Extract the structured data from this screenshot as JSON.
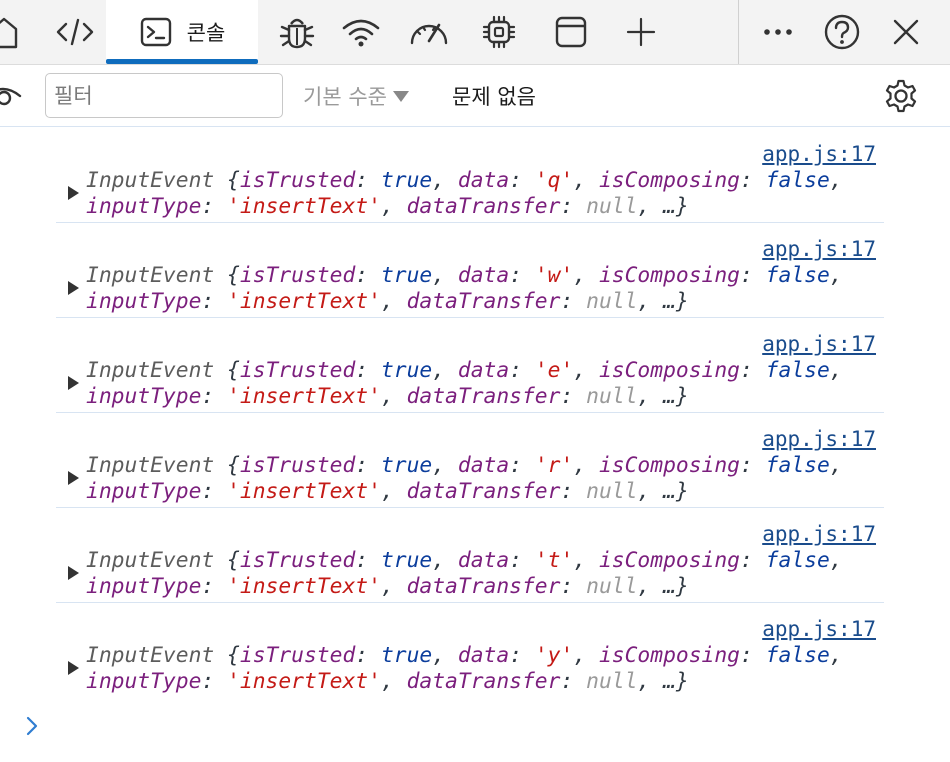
{
  "tabs": {
    "console_label": "콘솔"
  },
  "toolbar": {
    "filter_placeholder": "필터",
    "level_label": "기본 수준",
    "issues_label": "문제 없음"
  },
  "log": [
    {
      "source": "app.js:17",
      "class": "InputEvent",
      "isTrusted": "true",
      "data": "'q'",
      "isComposing": "false",
      "inputType": "'insertText'",
      "dataTransfer": "null"
    },
    {
      "source": "app.js:17",
      "class": "InputEvent",
      "isTrusted": "true",
      "data": "'w'",
      "isComposing": "false",
      "inputType": "'insertText'",
      "dataTransfer": "null"
    },
    {
      "source": "app.js:17",
      "class": "InputEvent",
      "isTrusted": "true",
      "data": "'e'",
      "isComposing": "false",
      "inputType": "'insertText'",
      "dataTransfer": "null"
    },
    {
      "source": "app.js:17",
      "class": "InputEvent",
      "isTrusted": "true",
      "data": "'r'",
      "isComposing": "false",
      "inputType": "'insertText'",
      "dataTransfer": "null"
    },
    {
      "source": "app.js:17",
      "class": "InputEvent",
      "isTrusted": "true",
      "data": "'t'",
      "isComposing": "false",
      "inputType": "'insertText'",
      "dataTransfer": "null"
    },
    {
      "source": "app.js:17",
      "class": "InputEvent",
      "isTrusted": "true",
      "data": "'y'",
      "isComposing": "false",
      "inputType": "'insertText'",
      "dataTransfer": "null"
    }
  ],
  "colors": {
    "accent": "#0f6cbd",
    "property": "#7b1f7d",
    "keyword": "#0b3d9c",
    "string": "#c41a16",
    "null": "#9a9a9a"
  },
  "icons": [
    "home-icon",
    "elements-icon",
    "console-icon",
    "bug-icon",
    "wifi-icon",
    "performance-icon",
    "chip-icon",
    "app-window-icon",
    "plus-icon",
    "more-icon",
    "help-icon",
    "close-icon",
    "eye-icon",
    "gear-icon"
  ]
}
